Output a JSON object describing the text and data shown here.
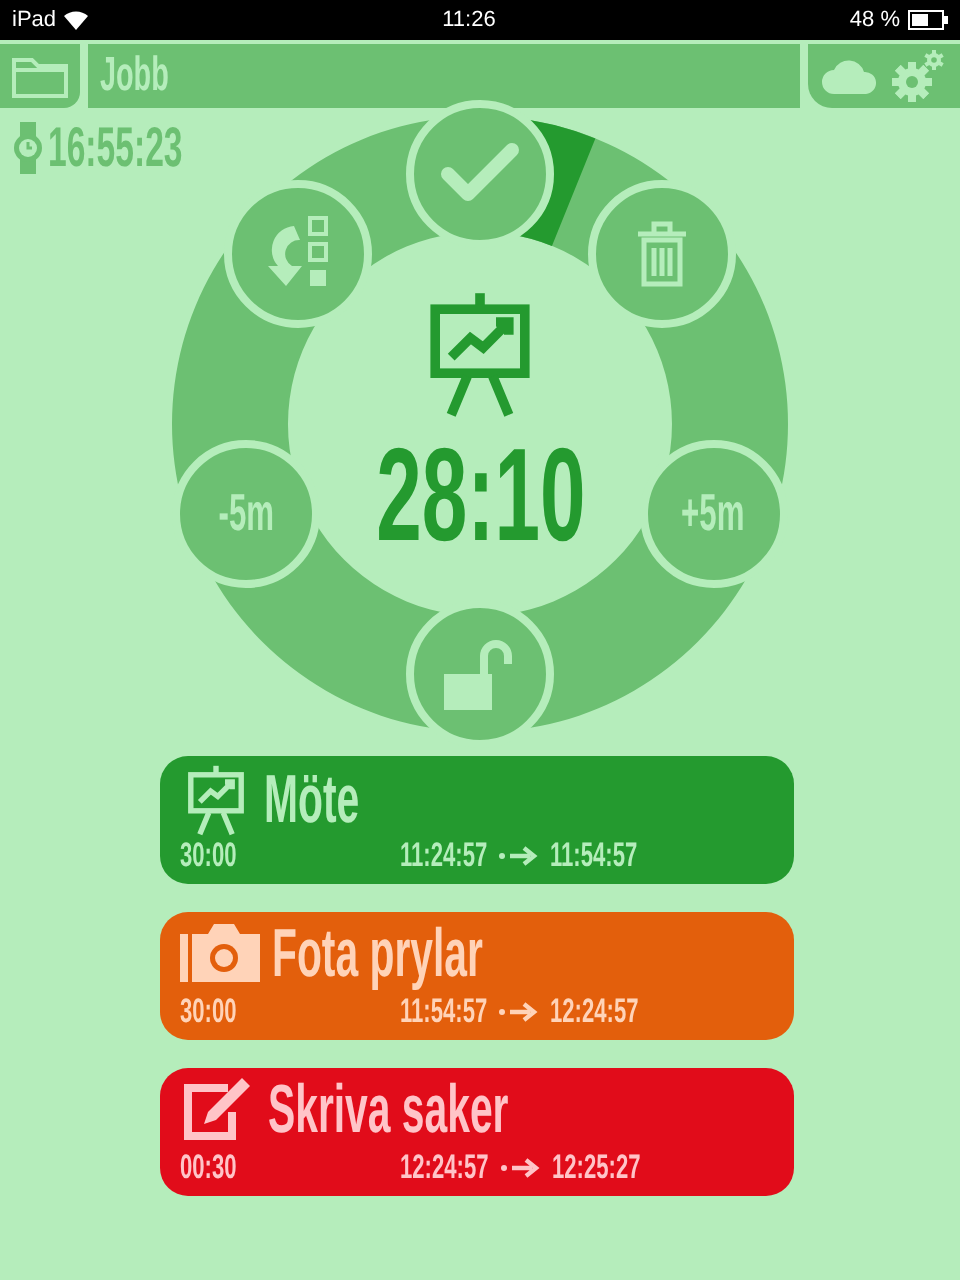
{
  "status_bar": {
    "device": "iPad",
    "time": "11:26",
    "battery": "48 %"
  },
  "header": {
    "title": "Jobb"
  },
  "clock": {
    "time": "16:55:23"
  },
  "wheel": {
    "timer": "28:10",
    "buttons": [
      {
        "kind": "done"
      },
      {
        "kind": "reorder"
      },
      {
        "kind": "delete"
      },
      {
        "kind": "text",
        "label": "-5m"
      },
      {
        "kind": "text",
        "label": "+5m"
      },
      {
        "kind": "unlock"
      }
    ]
  },
  "tasks": [
    {
      "kind": "presentation",
      "name": "Möte",
      "duration": "30:00",
      "start": "11:24:57",
      "end": "11:54:57",
      "color": "#249a2f"
    },
    {
      "kind": "camera",
      "name": "Fota prylar",
      "duration": "30:00",
      "start": "11:54:57",
      "end": "12:24:57",
      "color": "#e35f0c"
    },
    {
      "kind": "edit",
      "name": "Skriva saker",
      "duration": "00:30",
      "start": "12:24:57",
      "end": "12:25:27",
      "color": "#e10c1a"
    }
  ]
}
